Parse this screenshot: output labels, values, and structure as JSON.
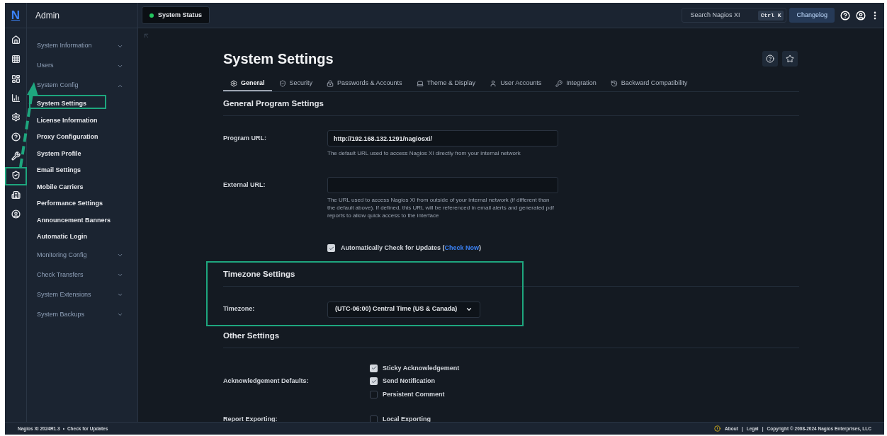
{
  "logo": "N",
  "sidebar": {
    "title": "Admin",
    "items": [
      {
        "label": "System Information",
        "expanded": false
      },
      {
        "label": "Users",
        "expanded": false
      },
      {
        "label": "System Config",
        "expanded": true,
        "children": [
          {
            "label": "System Settings"
          },
          {
            "label": "License Information"
          },
          {
            "label": "Proxy Configuration"
          },
          {
            "label": "System Profile"
          },
          {
            "label": "Email Settings"
          },
          {
            "label": "Mobile Carriers"
          },
          {
            "label": "Performance Settings"
          },
          {
            "label": "Announcement Banners"
          },
          {
            "label": "Automatic Login"
          }
        ]
      },
      {
        "label": "Monitoring Config",
        "expanded": false
      },
      {
        "label": "Check Transfers",
        "expanded": false
      },
      {
        "label": "System Extensions",
        "expanded": false
      },
      {
        "label": "System Backups",
        "expanded": false
      }
    ]
  },
  "topbar": {
    "status": "System Status",
    "search_placeholder": "Search Nagios XI",
    "shortcut": "Ctrl K",
    "changelog": "Changelog"
  },
  "page": {
    "title": "System Settings",
    "tabs": [
      {
        "label": "General",
        "selected": true
      },
      {
        "label": "Security",
        "selected": false
      },
      {
        "label": "Passwords & Accounts",
        "selected": false
      },
      {
        "label": "Theme & Display",
        "selected": false
      },
      {
        "label": "User Accounts",
        "selected": false
      },
      {
        "label": "Integration",
        "selected": false
      },
      {
        "label": "Backward Compatibility",
        "selected": false
      }
    ],
    "sections": [
      {
        "title": "General Program Settings",
        "rows": [
          {
            "kind": "text",
            "label": "Program URL:",
            "value": "http://192.168.132.1291/nagiosxi/",
            "help": "The default URL used to access Nagios XI directly from your internal network"
          },
          {
            "kind": "text",
            "label": "External URL:",
            "help": "The URL used to access Nagios XI from outside of your internal network (if different than the default above). If defined, this URL will be referenced in email alerts and generated pdf reports to allow quick access to the interface"
          },
          {
            "kind": "checkbox",
            "checked": true,
            "text": "Automatically Check for Updates (",
            "link": "Check Now",
            "text_after": ")"
          }
        ]
      },
      {
        "title": "Timezone Settings",
        "rows": [
          {
            "kind": "select",
            "label": "Timezone:",
            "value": "(UTC-06:00) Central Time (US & Canada)"
          }
        ]
      },
      {
        "title": "Other Settings",
        "rows": [
          {
            "kind": "checkgroup",
            "label": "Acknowledgement Defaults:",
            "options": [
              {
                "label": "Sticky Acknowledgement",
                "checked": true
              },
              {
                "label": "Send Notification",
                "checked": true
              },
              {
                "label": "Persistent Comment",
                "checked": false
              }
            ]
          },
          {
            "kind": "checkgroup",
            "label": "Report Exporting:",
            "options": [
              {
                "label": "Local Exporting",
                "checked": false
              }
            ]
          }
        ]
      }
    ]
  },
  "footer": {
    "version": "Nagios XI 2024R1.3",
    "separator": "•",
    "update_link": "Check for Updates",
    "links": [
      "About",
      "Legal"
    ],
    "divider": "|",
    "copyright": "Copyright © 2008-2024 Nagios Enterprises, LLC"
  }
}
